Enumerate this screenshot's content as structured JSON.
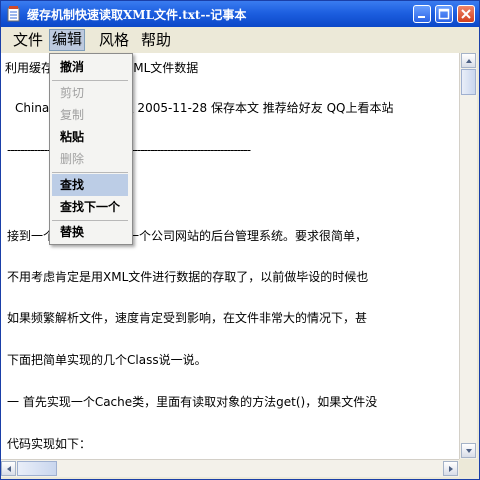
{
  "window": {
    "title": "缓存机制快速读取XML文件.txt--记事本"
  },
  "menubar": {
    "items": [
      {
        "label": "文件"
      },
      {
        "label": "编辑"
      },
      {
        "label": "风格"
      },
      {
        "label": "帮助"
      }
    ]
  },
  "edit_menu": {
    "items": [
      {
        "label": "撤消",
        "enabled": true
      },
      {
        "label": "剪切",
        "enabled": false
      },
      {
        "label": "复制",
        "enabled": false
      },
      {
        "label": "粘贴",
        "enabled": true
      },
      {
        "label": "删除",
        "enabled": false
      },
      {
        "label": "查找",
        "enabled": true,
        "highlighted": true
      },
      {
        "label": "查找下一个",
        "enabled": true
      },
      {
        "label": "替换",
        "enabled": true
      }
    ]
  },
  "document": {
    "lines": [
      "利用缓存机制快速读取XML文件数据",
      "ChinaITLab  收集整理  2005-11-28  保存本文  推荐给好友  QQ上看本站",
      "-------------------------------------------------------------------------",
      "    接到一个任务，让我做一个公司网站的后台管理系统。要求很简单，",
      "    不用考虑肯定是用XML文件进行数据的存取了，以前做毕设的时候也",
      "    如果频繁解析文件，速度肯定受到影响，在文件非常大的情况下，甚",
      "    下面把简单实现的几个Class说一说。",
      "    一 首先实现一个Cache类，里面有读取对象的方法get()，如果文件没",
      "    代码实现如下："
    ]
  }
}
